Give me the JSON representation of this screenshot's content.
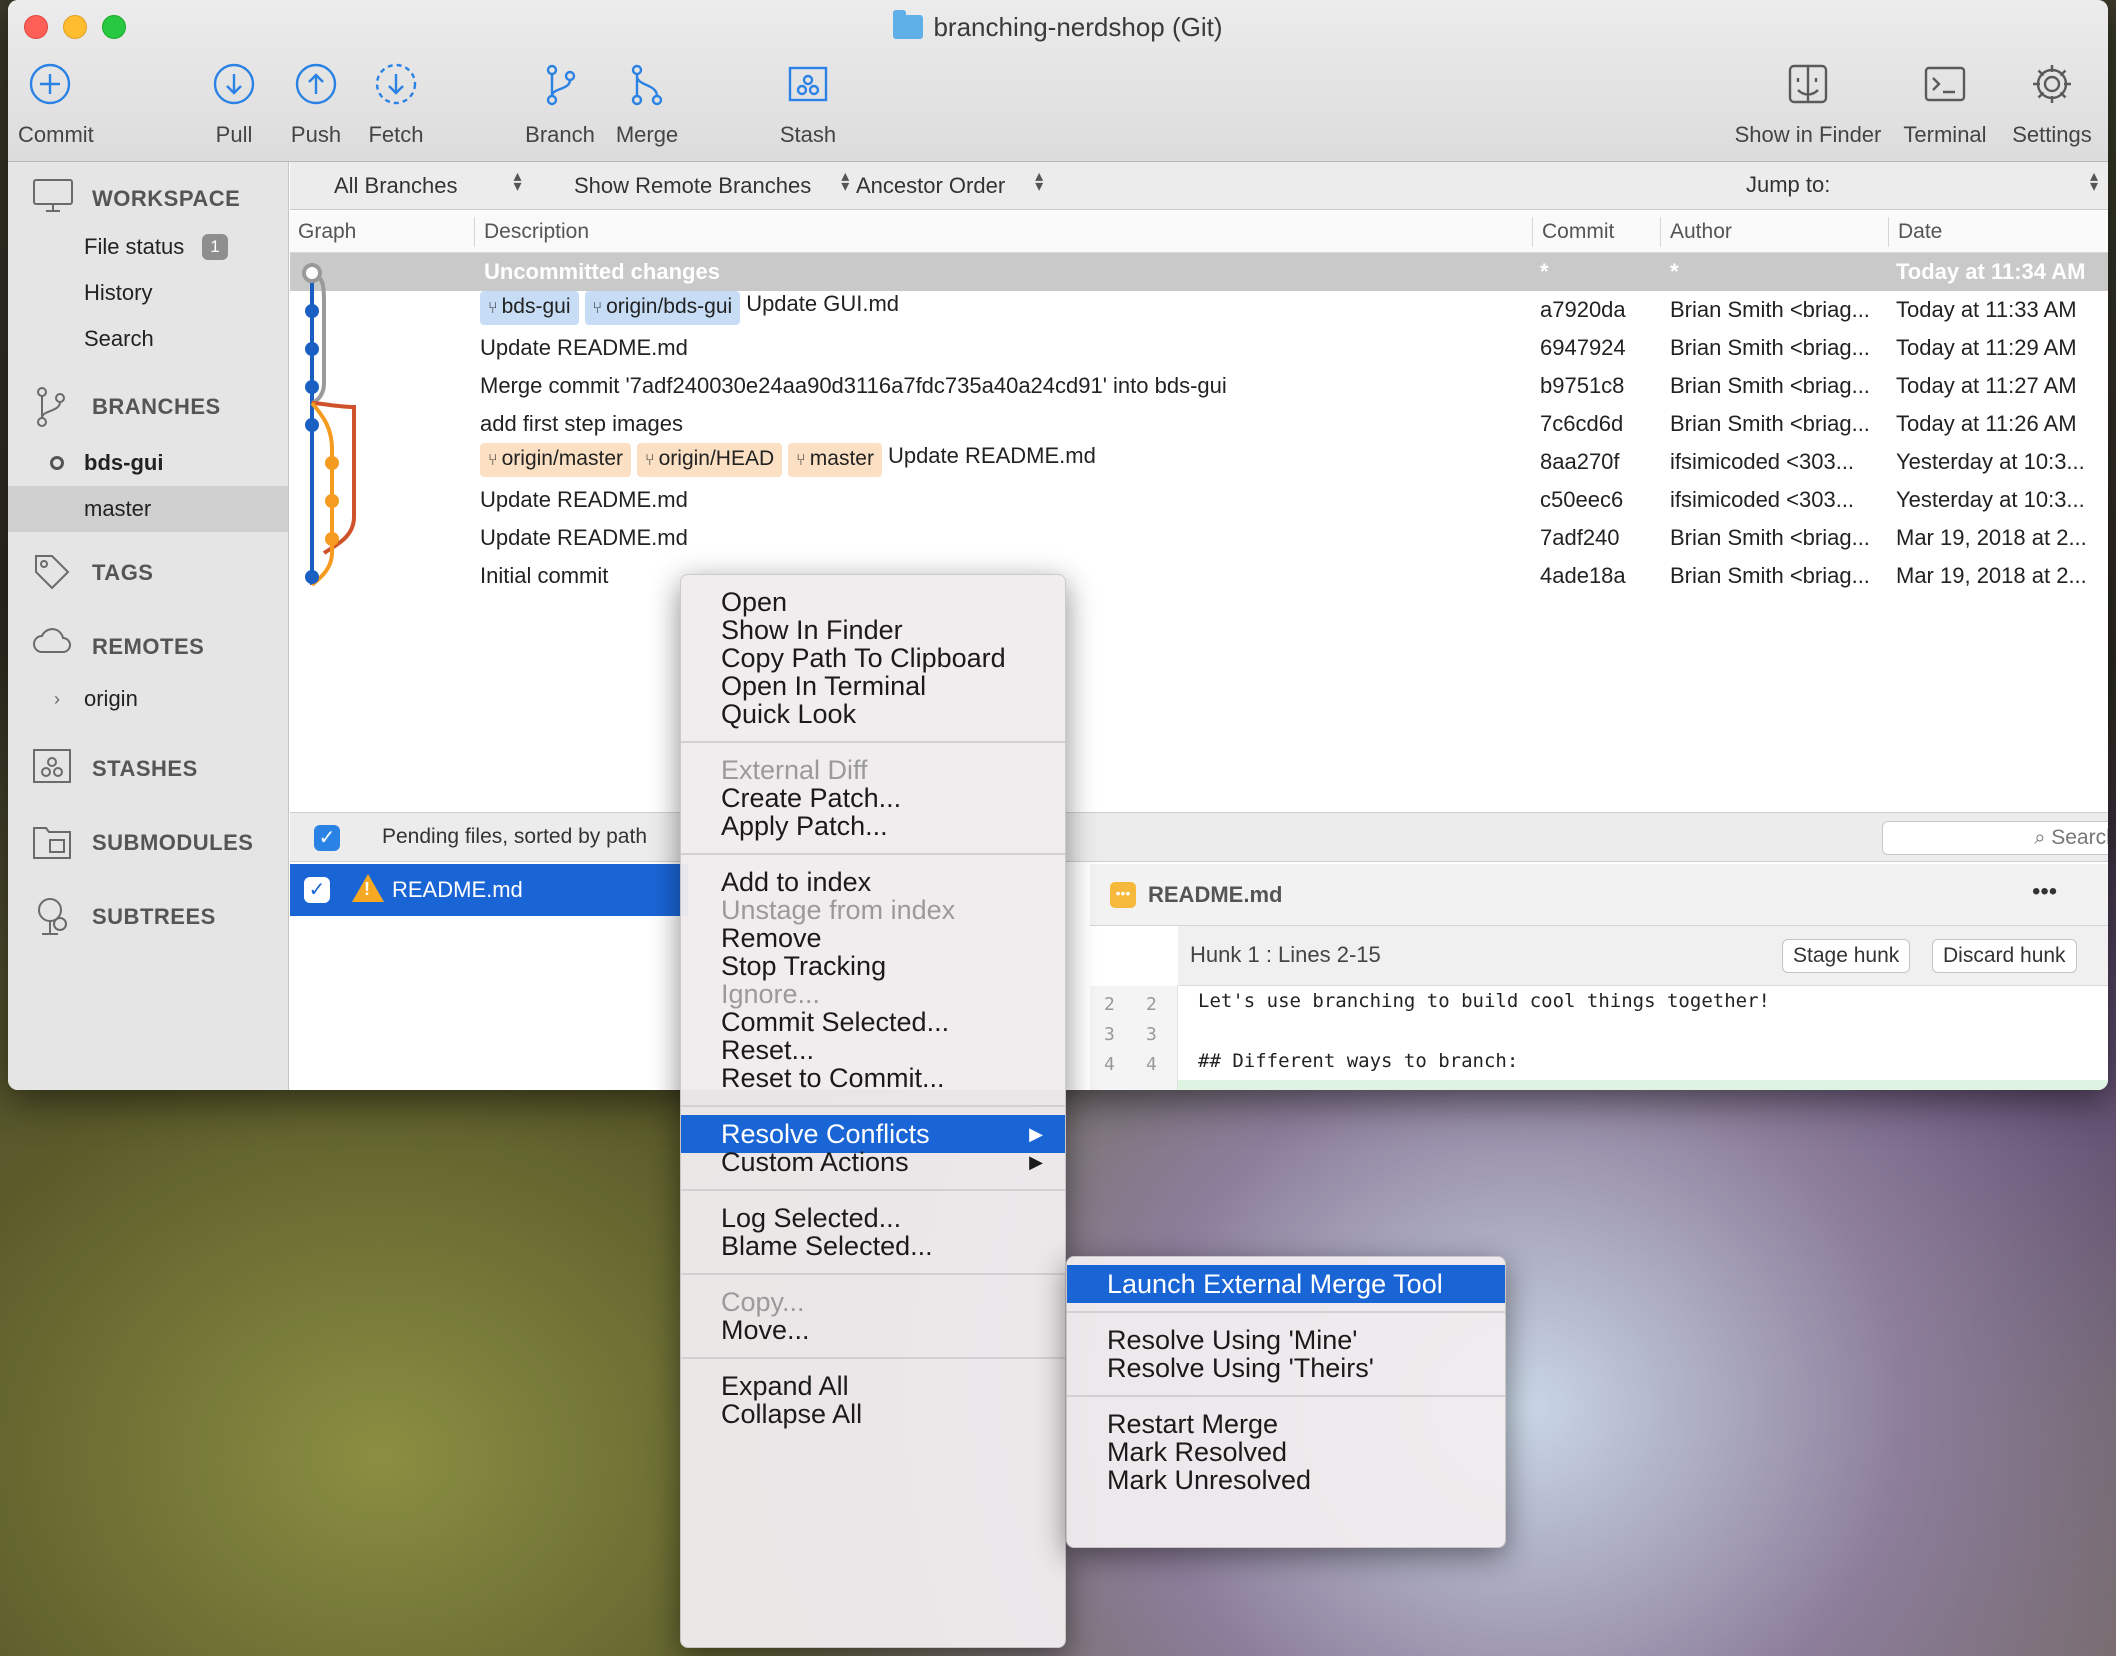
{
  "window": {
    "title": "branching-nerdshop (Git)"
  },
  "toolbar": {
    "commit": "Commit",
    "pull": "Pull",
    "push": "Push",
    "fetch": "Fetch",
    "branch": "Branch",
    "merge": "Merge",
    "stash": "Stash",
    "show_in_finder": "Show in Finder",
    "terminal": "Terminal",
    "settings": "Settings"
  },
  "sidebar": {
    "workspace": "WORKSPACE",
    "file_status": "File status",
    "file_status_count": "1",
    "history": "History",
    "search": "Search",
    "branches": "BRANCHES",
    "branch_current": "bds-gui",
    "branch_master": "master",
    "tags": "TAGS",
    "remotes": "REMOTES",
    "remote_origin": "origin",
    "stashes": "STASHES",
    "submodules": "SUBMODULES",
    "subtrees": "SUBTREES"
  },
  "filters": {
    "branches": "All Branches",
    "remote": "Show Remote Branches",
    "order": "Ancestor Order",
    "jump_to": "Jump to:"
  },
  "columns": {
    "graph": "Graph",
    "description": "Description",
    "commit": "Commit",
    "author": "Author",
    "date": "Date"
  },
  "uncommitted": {
    "desc": "Uncommitted changes",
    "commit": "*",
    "author": "*",
    "date": "Today at 11:34 AM"
  },
  "commits": [
    {
      "tags": [
        "bds-gui",
        "origin/bds-gui"
      ],
      "tag_color": "blue",
      "desc": "Update GUI.md",
      "commit": "a7920da",
      "author": "Brian Smith <briag...",
      "date": "Today at 11:33 AM"
    },
    {
      "tags": [],
      "desc": "Update README.md",
      "commit": "6947924",
      "author": "Brian Smith <briag...",
      "date": "Today at 11:29 AM"
    },
    {
      "tags": [],
      "desc": "Merge commit '7adf240030e24aa90d3116a7fdc735a40a24cd91' into bds-gui",
      "commit": "b9751c8",
      "author": "Brian Smith <briag...",
      "date": "Today at 11:27 AM"
    },
    {
      "tags": [],
      "desc": "add first step images",
      "commit": "7c6cd6d",
      "author": "Brian Smith <briag...",
      "date": "Today at 11:26 AM"
    },
    {
      "tags": [
        "origin/master",
        "origin/HEAD",
        "master"
      ],
      "tag_color": "orange",
      "desc": "Update README.md",
      "commit": "8aa270f",
      "author": "ifsimicoded <303...",
      "date": "Yesterday at 10:3..."
    },
    {
      "tags": [],
      "desc": "Update README.md",
      "commit": "c50eec6",
      "author": "ifsimicoded <303...",
      "date": "Yesterday at 10:3..."
    },
    {
      "tags": [],
      "desc": "Update README.md",
      "commit": "7adf240",
      "author": "Brian Smith <briag...",
      "date": "Mar 19, 2018 at 2..."
    },
    {
      "tags": [],
      "desc": "Initial commit",
      "commit": "4ade18a",
      "author": "Brian Smith <briag...",
      "date": "Mar 19, 2018 at 2..."
    }
  ],
  "pending": {
    "label": "Pending files, sorted by path",
    "search_placeholder": "Search",
    "file": "README.md"
  },
  "diff": {
    "file": "README.md",
    "more": "•••",
    "hunk": "Hunk 1 : Lines 2-15",
    "stage": "Stage hunk",
    "discard": "Discard hunk",
    "lines": [
      {
        "old": "2",
        "new": "2",
        "text": "Let's use branching to build cool things together!"
      },
      {
        "old": "3",
        "new": "3",
        "text": ""
      },
      {
        "old": "4",
        "new": "4",
        "text": "## Different ways to branch:"
      }
    ]
  },
  "context_menu": {
    "groups": [
      [
        {
          "label": "Open"
        },
        {
          "label": "Show In Finder"
        },
        {
          "label": "Copy Path To Clipboard"
        },
        {
          "label": "Open In Terminal"
        },
        {
          "label": "Quick Look"
        }
      ],
      [
        {
          "label": "External Diff",
          "disabled": true
        },
        {
          "label": "Create Patch..."
        },
        {
          "label": "Apply Patch..."
        }
      ],
      [
        {
          "label": "Add to index"
        },
        {
          "label": "Unstage from index",
          "disabled": true
        },
        {
          "label": "Remove"
        },
        {
          "label": "Stop Tracking"
        },
        {
          "label": "Ignore...",
          "disabled": true
        },
        {
          "label": "Commit Selected..."
        },
        {
          "label": "Reset..."
        },
        {
          "label": "Reset to Commit..."
        }
      ],
      [
        {
          "label": "Resolve Conflicts",
          "submenu": true,
          "highlighted": true
        },
        {
          "label": "Custom Actions",
          "submenu": true
        }
      ],
      [
        {
          "label": "Log Selected..."
        },
        {
          "label": "Blame Selected..."
        }
      ],
      [
        {
          "label": "Copy...",
          "disabled": true
        },
        {
          "label": "Move..."
        }
      ],
      [
        {
          "label": "Expand All"
        },
        {
          "label": "Collapse All"
        }
      ]
    ]
  },
  "submenu": {
    "groups": [
      [
        {
          "label": "Launch External Merge Tool",
          "highlighted": true
        }
      ],
      [
        {
          "label": "Resolve Using 'Mine'"
        },
        {
          "label": "Resolve Using 'Theirs'"
        }
      ],
      [
        {
          "label": "Restart Merge"
        },
        {
          "label": "Mark Resolved"
        },
        {
          "label": "Mark Unresolved"
        }
      ]
    ]
  },
  "colors": {
    "accent": "#1a65d6",
    "graph_blue": "#1a5fc2",
    "graph_orange": "#f59b1f",
    "graph_red": "#d0522a",
    "graph_gray": "#9a9a9a"
  }
}
